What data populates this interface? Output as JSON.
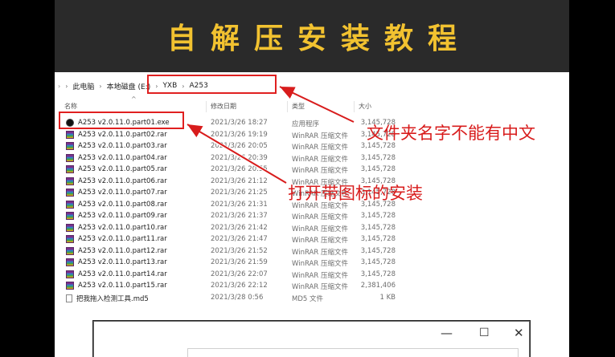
{
  "banner": {
    "title": "自解压安装教程"
  },
  "breadcrumb": {
    "items": [
      "此电脑",
      "本地磁盘 (E:)",
      "YXB",
      "A253"
    ]
  },
  "columns": {
    "name": "名称",
    "date": "修改日期",
    "type": "类型",
    "size": "大小"
  },
  "files": [
    {
      "icon": "exe-icon",
      "name": "A253 v2.0.11.0.part01.exe",
      "date": "2021/3/26 18:27",
      "type": "应用程序",
      "size": "3,145,728"
    },
    {
      "icon": "rar-icon",
      "name": "A253 v2.0.11.0.part02.rar",
      "date": "2021/3/26 19:19",
      "type": "WinRAR 压缩文件",
      "size": "3,145,728"
    },
    {
      "icon": "rar-icon",
      "name": "A253 v2.0.11.0.part03.rar",
      "date": "2021/3/26 20:05",
      "type": "WinRAR 压缩文件",
      "size": "3,145,728"
    },
    {
      "icon": "rar-icon",
      "name": "A253 v2.0.11.0.part04.rar",
      "date": "2021/3/26 20:39",
      "type": "WinRAR 压缩文件",
      "size": "3,145,728"
    },
    {
      "icon": "rar-icon",
      "name": "A253 v2.0.11.0.part05.rar",
      "date": "2021/3/26 20:55",
      "type": "WinRAR 压缩文件",
      "size": "3,145,728"
    },
    {
      "icon": "rar-icon",
      "name": "A253 v2.0.11.0.part06.rar",
      "date": "2021/3/26 21:12",
      "type": "WinRAR 压缩文件",
      "size": "3,145,728"
    },
    {
      "icon": "rar-icon",
      "name": "A253 v2.0.11.0.part07.rar",
      "date": "2021/3/26 21:25",
      "type": "WinRAR 压缩文件",
      "size": "3,145,728"
    },
    {
      "icon": "rar-icon",
      "name": "A253 v2.0.11.0.part08.rar",
      "date": "2021/3/26 21:31",
      "type": "WinRAR 压缩文件",
      "size": "3,145,728"
    },
    {
      "icon": "rar-icon",
      "name": "A253 v2.0.11.0.part09.rar",
      "date": "2021/3/26 21:37",
      "type": "WinRAR 压缩文件",
      "size": "3,145,728"
    },
    {
      "icon": "rar-icon",
      "name": "A253 v2.0.11.0.part10.rar",
      "date": "2021/3/26 21:42",
      "type": "WinRAR 压缩文件",
      "size": "3,145,728"
    },
    {
      "icon": "rar-icon",
      "name": "A253 v2.0.11.0.part11.rar",
      "date": "2021/3/26 21:47",
      "type": "WinRAR 压缩文件",
      "size": "3,145,728"
    },
    {
      "icon": "rar-icon",
      "name": "A253 v2.0.11.0.part12.rar",
      "date": "2021/3/26 21:52",
      "type": "WinRAR 压缩文件",
      "size": "3,145,728"
    },
    {
      "icon": "rar-icon",
      "name": "A253 v2.0.11.0.part13.rar",
      "date": "2021/3/26 21:59",
      "type": "WinRAR 压缩文件",
      "size": "3,145,728"
    },
    {
      "icon": "rar-icon",
      "name": "A253 v2.0.11.0.part14.rar",
      "date": "2021/3/26 22:07",
      "type": "WinRAR 压缩文件",
      "size": "3,145,728"
    },
    {
      "icon": "rar-icon",
      "name": "A253 v2.0.11.0.part15.rar",
      "date": "2021/3/26 22:12",
      "type": "WinRAR 压缩文件",
      "size": "2,381,406"
    },
    {
      "icon": "md5-icon",
      "name": "把我拖入检测工具.md5",
      "date": "2021/3/28 0:56",
      "type": "MD5 文件",
      "size": "1 KB"
    }
  ],
  "annotations": {
    "folder_note": "文件夹名字不能有中文",
    "exe_note": "打开带图标的安装"
  },
  "dialog": {
    "minimize": "—",
    "maximize": "☐",
    "close": "✕"
  },
  "colors": {
    "banner_text": "#f2c230",
    "annotation_red": "#d81c1c"
  }
}
